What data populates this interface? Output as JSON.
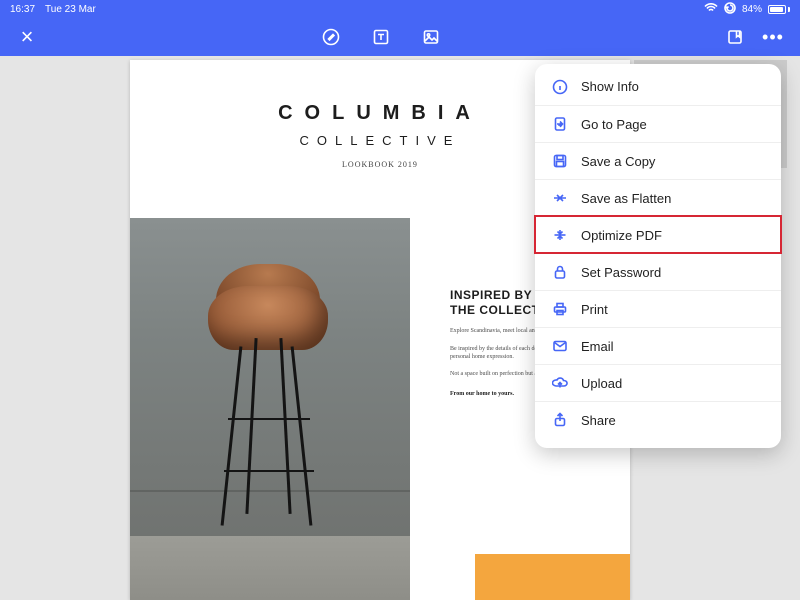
{
  "status": {
    "time": "16:37",
    "date": "Tue 23 Mar",
    "battery_pct": "84%"
  },
  "doc": {
    "title": "COLUMBIA",
    "subtitle": "COLLECTIVE",
    "lookbook": "LOOKBOOK 2019",
    "rhs_heading_l1": "INSPIRED BY",
    "rhs_heading_l2": "THE COLLECTIVE",
    "rhs_p1": "Explore Scandinavia, meet local and renowned designers.",
    "rhs_p2": "Be inspired by the details of each design and passion to find your personal home expression.",
    "rhs_p3": "Not a space built on perfection but a home made for living.",
    "rhs_tag": "From our home to yours."
  },
  "menu": {
    "items": [
      {
        "label": "Show Info",
        "icon": "info-icon"
      },
      {
        "label": "Go to Page",
        "icon": "goto-icon"
      },
      {
        "label": "Save a Copy",
        "icon": "save-icon"
      },
      {
        "label": "Save as Flatten",
        "icon": "flatten-icon"
      },
      {
        "label": "Optimize PDF",
        "icon": "optimize-icon"
      },
      {
        "label": "Set Password",
        "icon": "lock-icon"
      },
      {
        "label": "Print",
        "icon": "print-icon"
      },
      {
        "label": "Email",
        "icon": "email-icon"
      },
      {
        "label": "Upload",
        "icon": "upload-icon"
      },
      {
        "label": "Share",
        "icon": "share-icon"
      }
    ],
    "highlighted_index": 4
  }
}
